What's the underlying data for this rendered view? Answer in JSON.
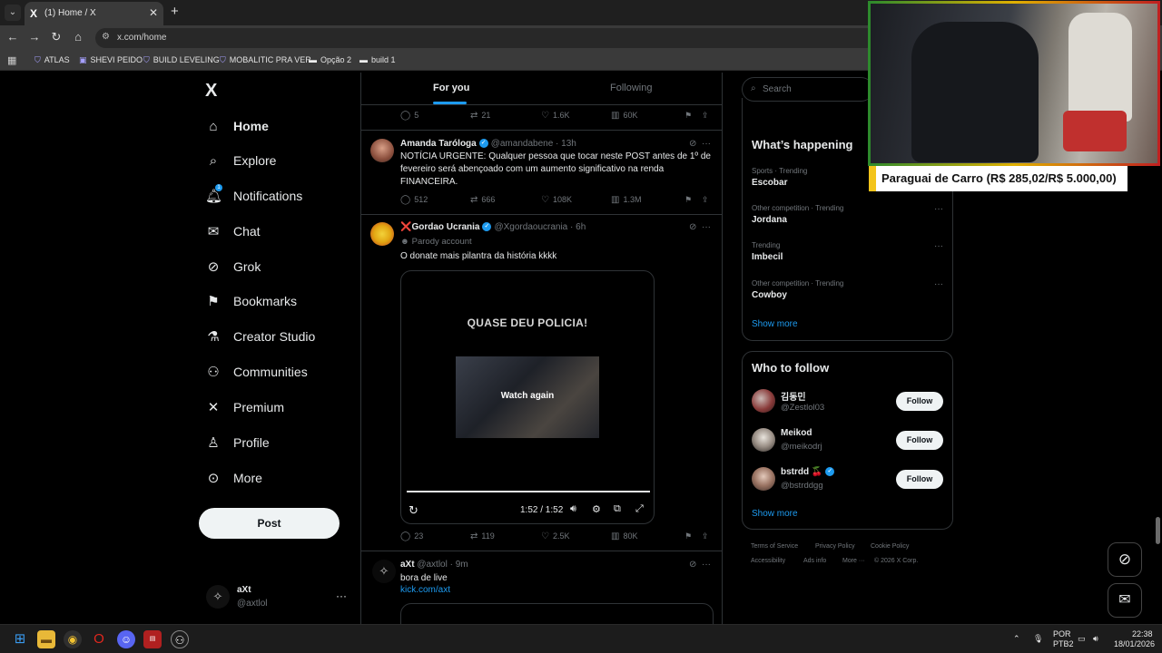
{
  "browser": {
    "tab_title": "(1) Home / X",
    "tab_favicon": "X",
    "url": "x.com/home",
    "bookmarks": [
      {
        "label": "ATLAS",
        "icon": "shield-icon"
      },
      {
        "label": "SHEVI PEIDO",
        "icon": "twitch-icon"
      },
      {
        "label": "BUILD LEVELING",
        "icon": "shield-icon"
      },
      {
        "label": "MOBALITIC PRA VER",
        "icon": "shield-icon"
      },
      {
        "label": "Opção 2",
        "icon": "bookmark-icon"
      },
      {
        "label": "build 1",
        "icon": "bookmark-icon"
      }
    ]
  },
  "sidebar": {
    "logo": "X",
    "items": [
      {
        "label": "Home",
        "icon": "home-icon",
        "active": true
      },
      {
        "label": "Explore",
        "icon": "search-icon"
      },
      {
        "label": "Notifications",
        "icon": "bell-icon",
        "badge": "1"
      },
      {
        "label": "Chat",
        "icon": "mail-icon"
      },
      {
        "label": "Grok",
        "icon": "grok-icon"
      },
      {
        "label": "Bookmarks",
        "icon": "bookmark-icon"
      },
      {
        "label": "Creator Studio",
        "icon": "flask-icon"
      },
      {
        "label": "Communities",
        "icon": "people-icon"
      },
      {
        "label": "Premium",
        "icon": "x-icon"
      },
      {
        "label": "Profile",
        "icon": "person-icon"
      },
      {
        "label": "More",
        "icon": "more-circle-icon"
      }
    ],
    "post_button": "Post",
    "account": {
      "name": "aXt",
      "handle": "@axtlol"
    }
  },
  "timeline": {
    "tabs": [
      "For you",
      "Following"
    ],
    "top_actions": {
      "replies": "5",
      "reposts": "21",
      "likes": "1.6K",
      "views": "60K"
    },
    "posts": [
      {
        "name": "Amanda Taróloga",
        "handle": "@amandabene",
        "time": "13h",
        "verified": true,
        "text": "NOTÍCIA URGENTE: Qualquer pessoa que tocar neste POST antes de 1º de fevereiro será abençoado com um aumento significativo na renda FINANCEIRA.",
        "actions": {
          "replies": "512",
          "reposts": "666",
          "likes": "108K",
          "views": "1.3M"
        }
      },
      {
        "name": "Gordao Ucrania",
        "name_prefix": "❌",
        "handle": "@Xgordaoucrania",
        "time": "6h",
        "verified": true,
        "parody": "Parody account",
        "text": "O donate mais pilantra da história kkkk",
        "media": {
          "title": "QUASE DEU POLICIA!",
          "overlay": "Watch again",
          "time": "1:52 / 1:52",
          "progress": 1.0
        },
        "actions": {
          "replies": "23",
          "reposts": "119",
          "likes": "2.5K",
          "views": "80K"
        }
      },
      {
        "name": "aXt",
        "handle": "@axtlol",
        "time": "9m",
        "verified": false,
        "text": "bora de live",
        "link": "kick.com/axt"
      }
    ]
  },
  "right": {
    "search_placeholder": "Search",
    "trending_title": "What’s happening",
    "trends": [
      {
        "meta": "Sports · Trending",
        "name": "Escobar"
      },
      {
        "meta": "Other competition · Trending",
        "name": "Jordana"
      },
      {
        "meta": "Trending",
        "name": "Imbecil"
      },
      {
        "meta": "Other competition · Trending",
        "name": "Cowboy"
      }
    ],
    "show_more": "Show more",
    "wtf_title": "Who to follow",
    "who_to_follow": [
      {
        "name": "김동민",
        "handle": "@Zestlol03",
        "button": "Follow"
      },
      {
        "name": "Meikod",
        "handle": "@meikodrj",
        "button": "Follow"
      },
      {
        "name": "bstrdd 🍒",
        "handle": "@bstrddgg",
        "button": "Follow",
        "verified": true
      }
    ],
    "footer": [
      "Terms of Service",
      "Privacy Policy",
      "Cookie Policy",
      "Accessibility",
      "Ads info",
      "More ···",
      "© 2026 X Corp."
    ]
  },
  "overlay": {
    "donation_text": "Paraguai de Carro (R$ 285,02/R$ 5.000,00)"
  },
  "taskbar": {
    "lang": "POR",
    "lang_sub": "PTB2",
    "time": "22:38",
    "date": "18/01/2026"
  }
}
